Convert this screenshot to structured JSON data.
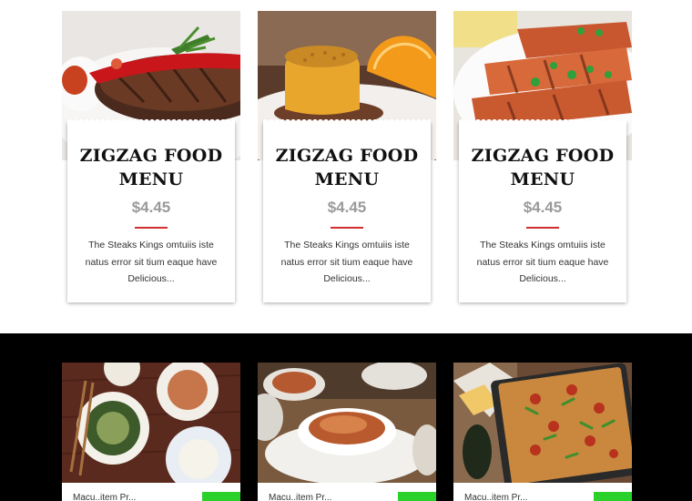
{
  "menu_cards": [
    {
      "title": "ZIGZAG FOOD MENU",
      "price": "$4.45",
      "description": "The Steaks Kings omtuiis iste natus error sit tium eaque have Delicious...",
      "image_icon": "steak-image"
    },
    {
      "title": "ZIGZAG FOOD MENU",
      "price": "$4.45",
      "description": "The Steaks Kings omtuiis iste natus error sit tium eaque have Delicious...",
      "image_icon": "dessert-image"
    },
    {
      "title": "ZIGZAG FOOD MENU",
      "price": "$4.45",
      "description": "The Steaks Kings omtuiis iste natus error sit tium eaque have Delicious...",
      "image_icon": "grilled-chicken-image"
    }
  ],
  "photo_cards": [
    {
      "caption": "Macu..item  Pr...",
      "image_icon": "asian-dishes-image"
    },
    {
      "caption": "Macu..item  Pr...",
      "image_icon": "pasta-bowl-image"
    },
    {
      "caption": "Macu..item  Pr...",
      "image_icon": "pizza-image"
    }
  ],
  "colors": {
    "accent_red": "#d32f2f",
    "price_gray": "#9a9a9a",
    "badge_green": "#2bd12b",
    "section_dark": "#000000"
  }
}
